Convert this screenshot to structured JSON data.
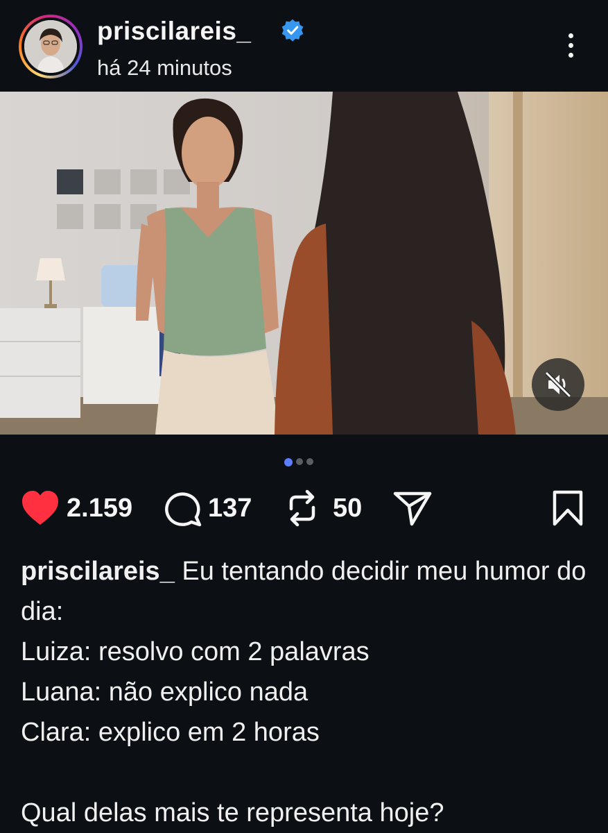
{
  "post": {
    "username": "priscilareis_",
    "timestamp": "há 24 minutos"
  },
  "stats": {
    "likes": "2.159",
    "comments": "137",
    "reposts": "50"
  },
  "caption": {
    "username": "priscilareis_",
    "text": "Eu tentando decidir meu humor do dia:\nLuiza: resolvo com 2 palavras\nLuana: não explico nada\nClara: explico em 2 horas\n\nQual delas mais te representa hoje?"
  },
  "carousel": {
    "count": 3,
    "active": 1
  },
  "colors": {
    "background": "#0c1014",
    "like": "#ff3040",
    "verified": "#3797f0",
    "active_dot": "#5b7fff"
  },
  "icons": [
    "verified-icon",
    "more-icon",
    "mute-icon",
    "heart-icon",
    "comment-icon",
    "repost-icon",
    "share-icon",
    "bookmark-icon"
  ]
}
